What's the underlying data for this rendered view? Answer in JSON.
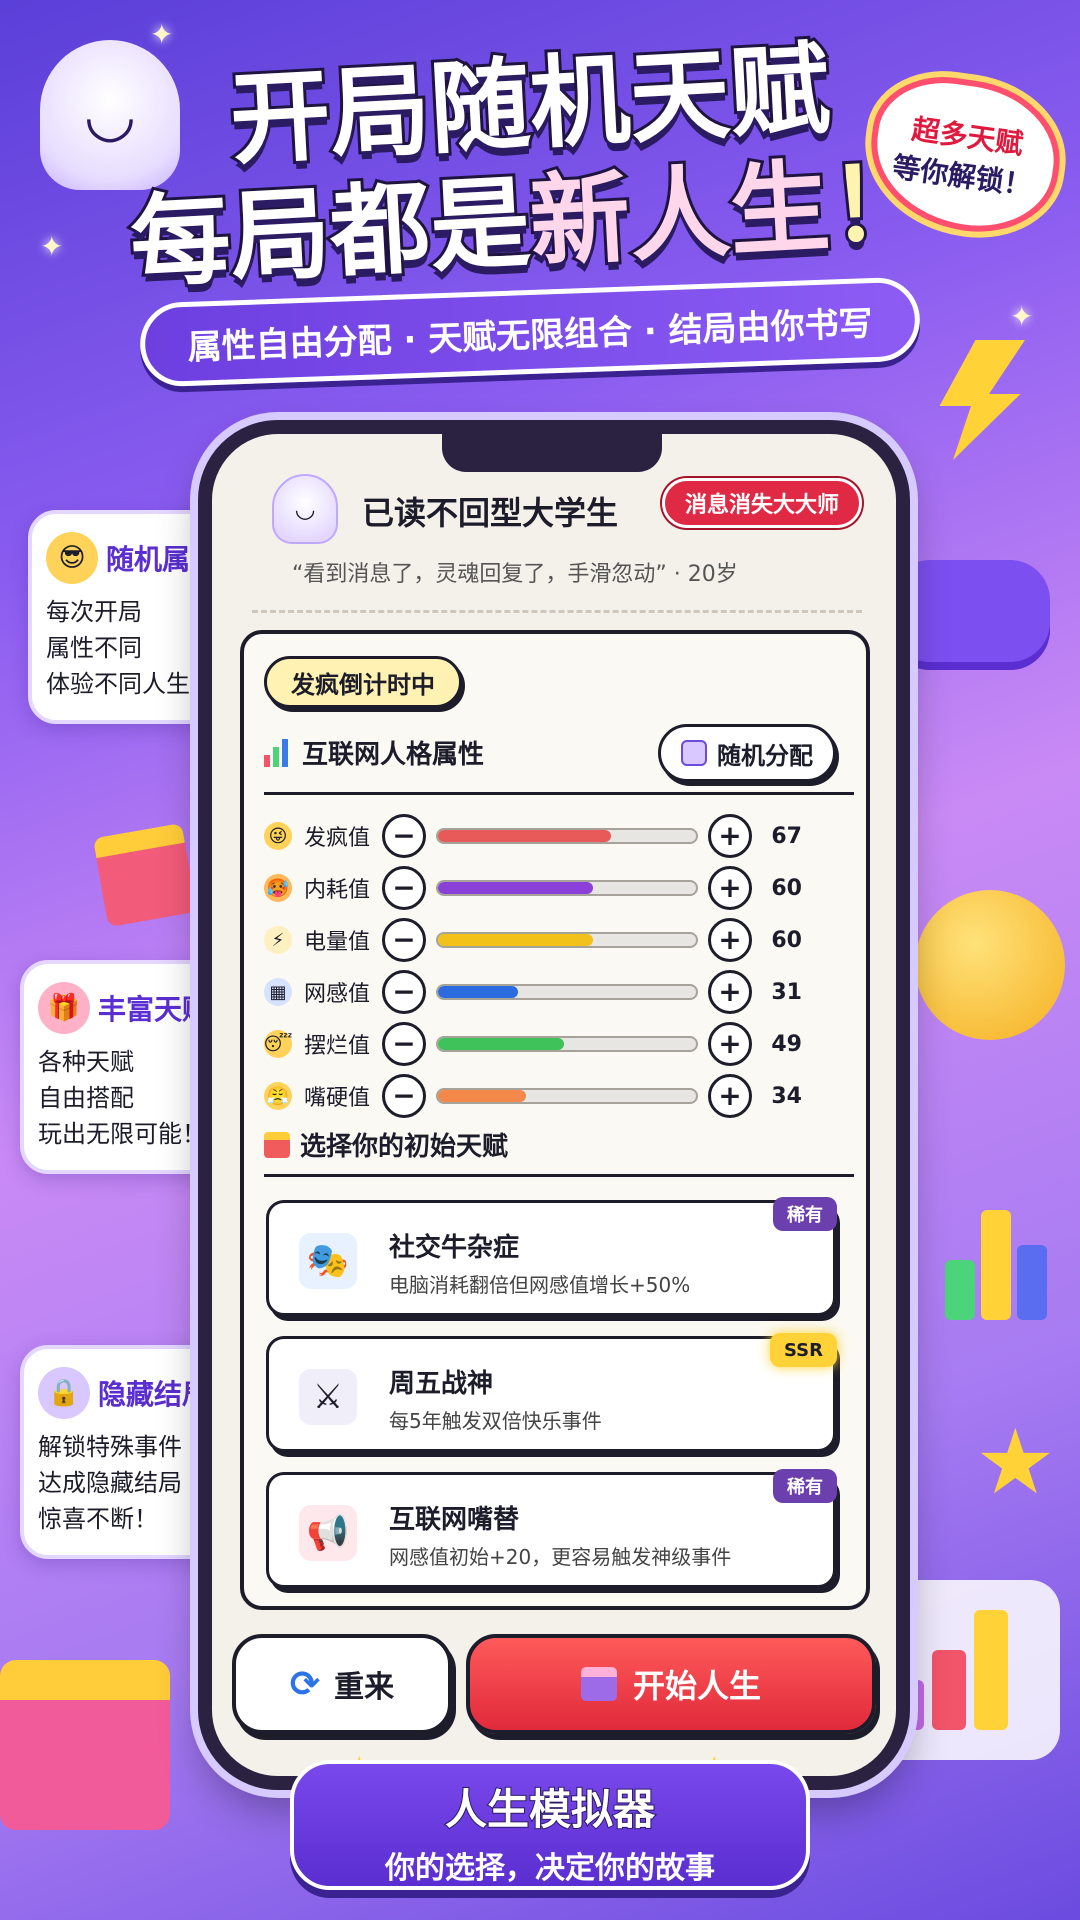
{
  "header": {
    "title_line1": "开局随机天赋",
    "title_line2_a": "每局都是",
    "title_line2_b": "新人生",
    "title_line2_c": "！",
    "subtitle": "属性自由分配 · 天赋无限组合 · 结局由你书写",
    "burst_line1": "超多天赋",
    "burst_line2": "等你解锁！"
  },
  "profile": {
    "name": "已读不回型大学生",
    "badge": "消息消失大大师",
    "quote": "“看到消息了，灵魂回复了，手滑忽动” · 20岁"
  },
  "panel": {
    "countdown": "发疯倒计时中",
    "attr_title": "互联网人格属性",
    "random_button": "随机分配",
    "talent_title": "选择你的初始天赋"
  },
  "stats": [
    {
      "name": "发疯值",
      "value": 67,
      "color": "#e85a5a",
      "emoji": "😜",
      "emoji_bg": "#ffd35a"
    },
    {
      "name": "内耗值",
      "value": 60,
      "color": "#8a3fd8",
      "emoji": "🥵",
      "emoji_bg": "#ffb85a"
    },
    {
      "name": "电量值",
      "value": 60,
      "color": "#f2c21a",
      "emoji": "⚡",
      "emoji_bg": "#fff0c2"
    },
    {
      "name": "网感值",
      "value": 31,
      "color": "#2a6be0",
      "emoji": "▦",
      "emoji_bg": "#d6e2ff"
    },
    {
      "name": "摆烂值",
      "value": 49,
      "color": "#3fc25a",
      "emoji": "😴",
      "emoji_bg": "#ffd35a"
    },
    {
      "name": "嘴硬值",
      "value": 34,
      "color": "#f2884a",
      "emoji": "😤",
      "emoji_bg": "#ffd35a"
    }
  ],
  "talents": [
    {
      "name": "社交牛杂症",
      "desc": "电脑消耗翻倍但网感值增长+50%",
      "rarity": "稀有",
      "rarity_type": "rare",
      "icon": "🎭",
      "icon_bg": "#e8f1ff"
    },
    {
      "name": "周五战神",
      "desc": "每5年触发双倍快乐事件",
      "rarity": "SSR",
      "rarity_type": "ssr",
      "icon": "⚔",
      "icon_bg": "#f0eef8"
    },
    {
      "name": "互联网嘴替",
      "desc": "网感值初始+20，更容易触发神级事件",
      "rarity": "稀有",
      "rarity_type": "rare",
      "icon": "📢",
      "icon_bg": "#ffe8ec"
    }
  ],
  "actions": {
    "restart": "重来",
    "start": "开始人生"
  },
  "callouts": [
    {
      "title": "随机属性",
      "lines": [
        "每次开局",
        "属性不同",
        "体验不同人生！"
      ],
      "emoji": "😎",
      "emoji_bg": "#ffd35a"
    },
    {
      "title": "丰富天赋",
      "lines": [
        "各种天赋",
        "自由搭配",
        "玩出无限可能！"
      ],
      "emoji": "🎁",
      "emoji_bg": "#ffb1c8"
    },
    {
      "title": "隐藏结局",
      "lines": [
        "解锁特殊事件",
        "达成隐藏结局",
        "惊喜不断！"
      ],
      "emoji": "🔒",
      "emoji_bg": "#d9c8ff"
    }
  ],
  "footer": {
    "title": "人生模拟器",
    "subtitle": "你的选择，决定你的故事"
  },
  "colors": {
    "accent_red": "#e02a45",
    "accent_purple": "#6b4be0",
    "ssr_gold": "#ffd338"
  }
}
